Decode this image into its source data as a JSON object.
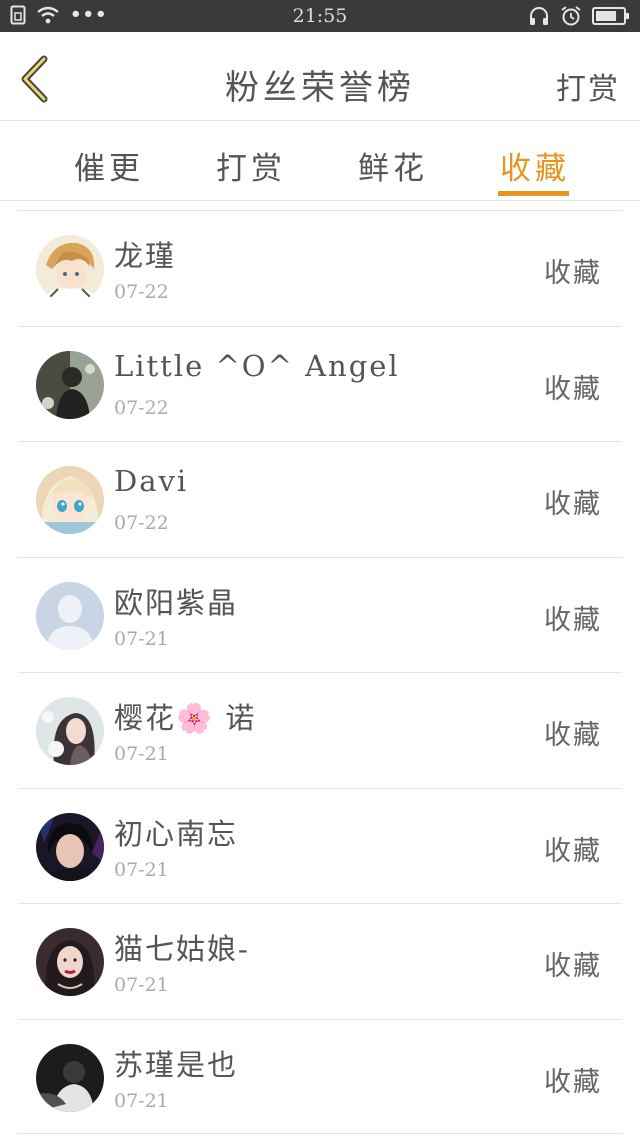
{
  "status_bar": {
    "time": "21:55",
    "dots": "•••"
  },
  "header": {
    "title": "粉丝荣誉榜",
    "action_label": "打赏"
  },
  "tabs": [
    {
      "label": "催更",
      "active": false
    },
    {
      "label": "打赏",
      "active": false
    },
    {
      "label": "鲜花",
      "active": false
    },
    {
      "label": "收藏",
      "active": true
    }
  ],
  "colors": {
    "accent": "#e8951f",
    "status_bar_bg": "#3a3a3a"
  },
  "fans": [
    {
      "name": "龙瑾",
      "date": "07-22",
      "action": "收藏",
      "avatar": "avatar-anime-boy"
    },
    {
      "name": "Little ^O^ Angel",
      "date": "07-22",
      "action": "收藏",
      "avatar": "avatar-dark-photo"
    },
    {
      "name": "Davi",
      "date": "07-22",
      "action": "收藏",
      "avatar": "avatar-anime-girl"
    },
    {
      "name": "欧阳紫晶",
      "date": "07-21",
      "action": "收藏",
      "avatar": "avatar-default"
    },
    {
      "name": "樱花🌸 诺",
      "date": "07-21",
      "action": "收藏",
      "avatar": "avatar-girl-photo"
    },
    {
      "name": "初心南忘",
      "date": "07-21",
      "action": "收藏",
      "avatar": "avatar-boy-photo"
    },
    {
      "name": "猫七姑娘-",
      "date": "07-21",
      "action": "收藏",
      "avatar": "avatar-woman-photo"
    },
    {
      "name": "苏瑾是也",
      "date": "07-21",
      "action": "收藏",
      "avatar": "avatar-bw-photo"
    }
  ]
}
